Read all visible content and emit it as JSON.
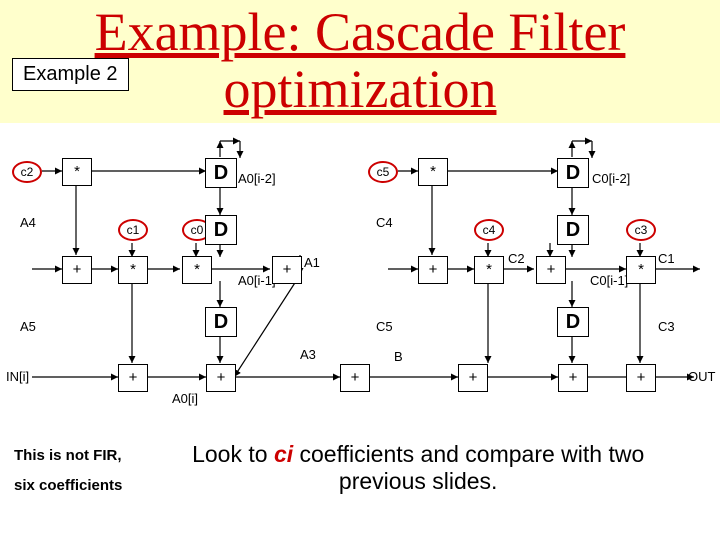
{
  "title": {
    "line1": "Example: Cascade Filter",
    "line2": "optimization"
  },
  "example_box": "Example 2",
  "coefs": {
    "c2": "c2",
    "c1": "c1",
    "c0": "c0",
    "c5": "c5",
    "c4": "c4",
    "c3": "c3"
  },
  "ops": {
    "mul": "*",
    "add": "+",
    "D": "D"
  },
  "labels": {
    "A4": "A4",
    "A5": "A5",
    "IN": "IN[i]",
    "A0i2": "A0[i-2]",
    "A0i1": "A0[i-1]",
    "A0i": "A0[i]",
    "A1": "A1",
    "A3": "A3",
    "B": "B",
    "C4": "C4",
    "C5": "C5",
    "C2": "C2",
    "C1": "C1",
    "C3": "C3",
    "C0i2": "C0[i-2]",
    "C0i1": "C0[i-1]",
    "OUT": "OUT"
  },
  "footer": {
    "left1": "This is not FIR,",
    "left2": "six coefficients",
    "right_pre": "Look to ",
    "ci": "ci",
    "right_mid": " coefficients and compare with two",
    "right_end": "previous slides."
  }
}
